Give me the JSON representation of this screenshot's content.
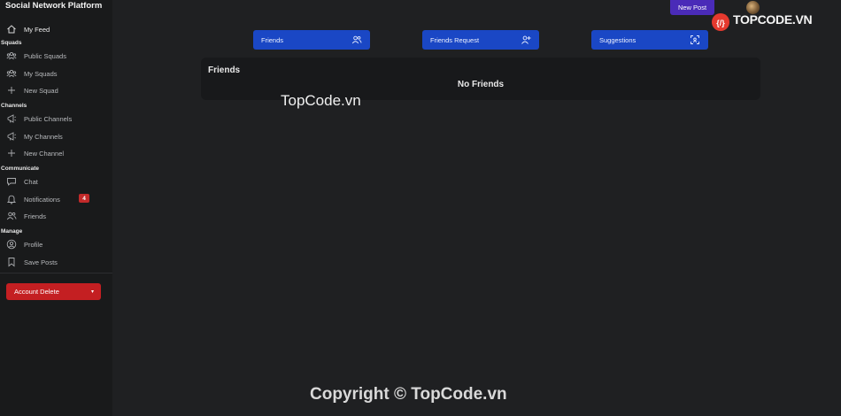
{
  "brand": "Social Network Platform",
  "nav": {
    "my_feed": "My Feed",
    "squads_heading": "Squads",
    "public_squads": "Public Squads",
    "my_squads": "My Squads",
    "new_squad": "New Squad",
    "channels_heading": "Channels",
    "public_channels": "Public Channels",
    "my_channels": "My Channels",
    "new_channel": "New Channel",
    "communicate_heading": "Communicate",
    "chat": "Chat",
    "notifications": "Notifications",
    "notifications_count": "4",
    "friends": "Friends",
    "manage_heading": "Manage",
    "profile": "Profile",
    "save_posts": "Save Posts"
  },
  "account_delete": {
    "label": "Account Delete",
    "caret": "▾"
  },
  "header": {
    "new_post": "New Post"
  },
  "tabs": [
    {
      "label": "Friends",
      "icon": "users-icon"
    },
    {
      "label": "Friends Request",
      "icon": "user-plus-icon"
    },
    {
      "label": "Suggestions",
      "icon": "scan-user-icon"
    }
  ],
  "card": {
    "title": "Friends",
    "empty_text": "No Friends"
  },
  "watermark": {
    "logo_text": "TOPCODE.VN",
    "center": "TopCode.vn",
    "bottom": "Copyright © TopCode.vn"
  },
  "colors": {
    "accent_blue": "#1a47c5",
    "new_post_purple": "#4a2bb8",
    "danger_red": "#c41f22",
    "badge_red": "#c22a2a",
    "background": "#1f2022",
    "sidebar": "#191a1b"
  }
}
